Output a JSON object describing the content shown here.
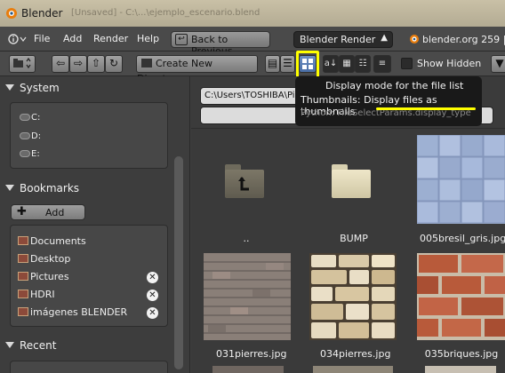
{
  "window": {
    "title": "Blender",
    "faded_title": "[Unsaved] - C:\\...\\ejemplo_escenario.blend"
  },
  "menubar": {
    "editor_type": "info",
    "items": [
      "File",
      "Add",
      "Render",
      "Help"
    ],
    "back_button": "Back to Previous",
    "render_engine": "Blender Render",
    "stats": "blender.org 259 |"
  },
  "toolbar": {
    "create_dir": "Create New Directory",
    "show_hidden": "Show Hidden",
    "show_hidden_checked": false,
    "display_mode": "thumbnails"
  },
  "tooltip": {
    "title": "Display mode for the file list",
    "description": "Thumbnails: Display files as thumbnails",
    "python": "Python: FileSelectParams.display_type"
  },
  "sidebar": {
    "system": {
      "heading": "System",
      "drives": [
        "C:",
        "D:",
        "E:"
      ]
    },
    "bookmarks": {
      "heading": "Bookmarks",
      "add_label": "Add",
      "items": [
        {
          "label": "Documents",
          "removable": false
        },
        {
          "label": "Desktop",
          "removable": false
        },
        {
          "label": "Pictures",
          "removable": true
        },
        {
          "label": "HDRI",
          "removable": true
        },
        {
          "label": "imágenes BLENDER",
          "removable": true
        }
      ]
    },
    "recent": {
      "heading": "Recent"
    }
  },
  "filebrowser": {
    "path": "C:\\Users\\TOSHIBA\\Pi",
    "files": [
      {
        "name": "..",
        "kind": "parent"
      },
      {
        "name": "BUMP",
        "kind": "folder"
      },
      {
        "name": "005bresil_gris.jpg",
        "kind": "image",
        "texture": "blue-tiles"
      },
      {
        "name": "031pierres.jpg",
        "kind": "image",
        "texture": "gray-bricks"
      },
      {
        "name": "034pierres.jpg",
        "kind": "image",
        "texture": "stone-wall"
      },
      {
        "name": "035briques.jpg",
        "kind": "image",
        "texture": "red-bricks"
      }
    ]
  },
  "colors": {
    "highlight": "#ffff00",
    "panel_bg": "#3d3d3d",
    "tooltip_bg": "#191919"
  }
}
